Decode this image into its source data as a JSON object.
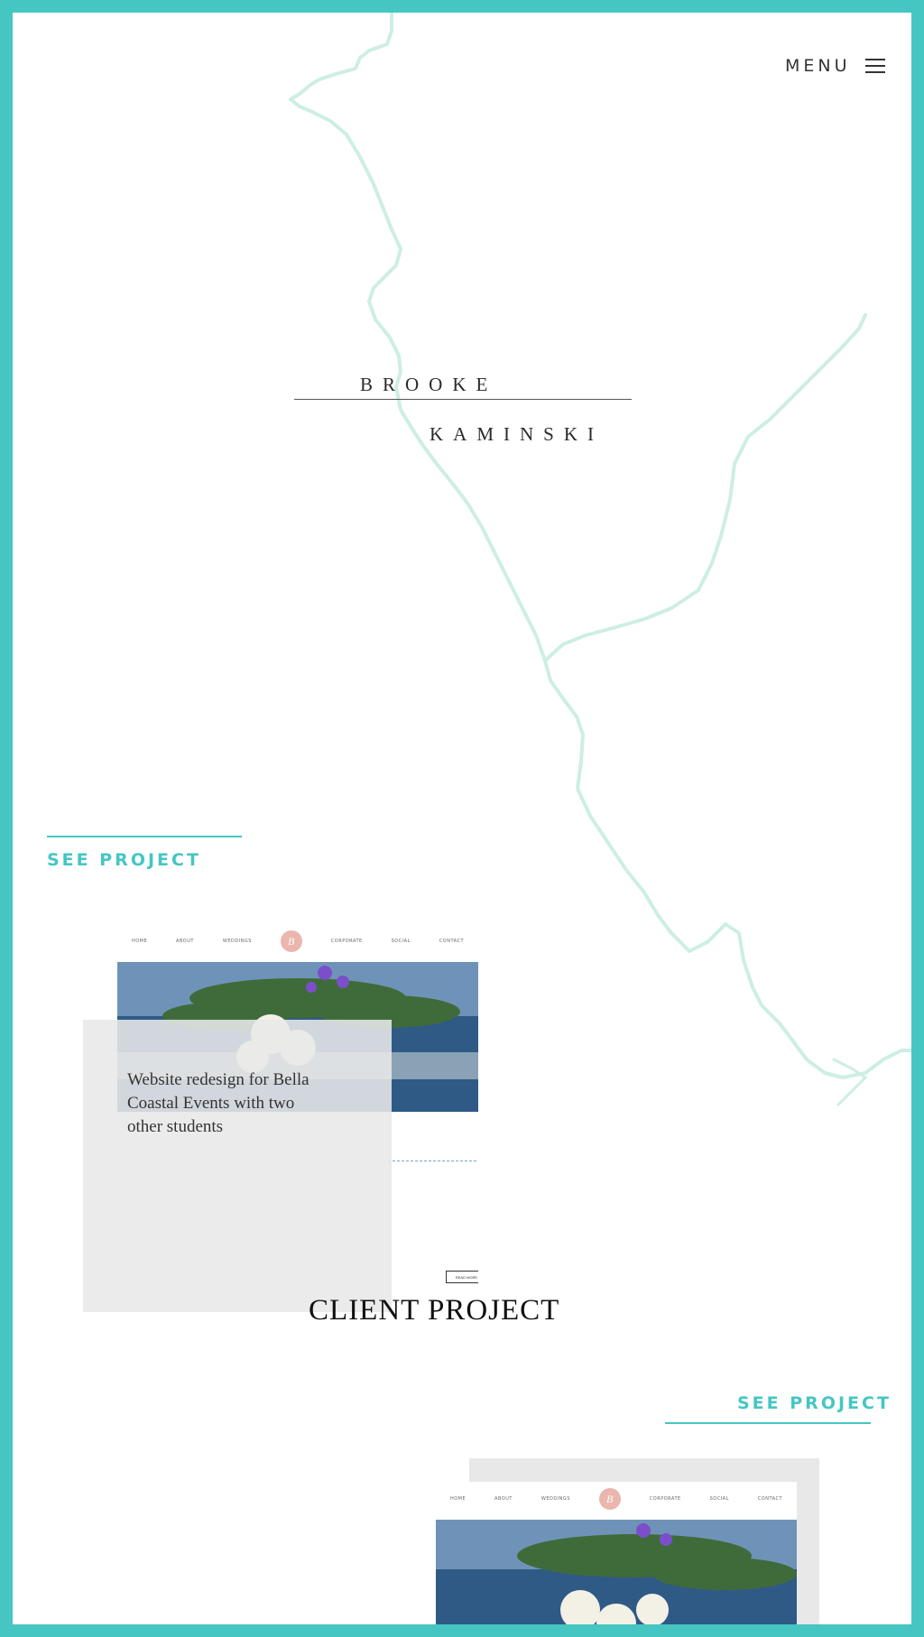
{
  "header": {
    "menu_label": "MENU"
  },
  "hero": {
    "first_name": "BROOKE",
    "last_name": "KAMINSKI"
  },
  "projects": [
    {
      "see_project_label": "SEE PROJECT",
      "description": "Website redesign for Bella Coastal Events with two other students",
      "title": "CLIENT PROJECT",
      "mock": {
        "nav_items": [
          "HOME",
          "ABOUT",
          "WEDDINGS",
          "CORPORATE",
          "SOCIAL",
          "CONTACT"
        ],
        "logo": "B",
        "read_more": "READ MORE"
      }
    },
    {
      "see_project_label": "SEE PROJECT",
      "mock": {
        "nav_items": [
          "HOME",
          "ABOUT",
          "WEDDINGS",
          "CORPORATE",
          "SOCIAL",
          "CONTACT"
        ],
        "logo": "B"
      }
    }
  ],
  "colors": {
    "frame": "#45c6c3",
    "accent": "#45c6c3",
    "river": "#cdeee4",
    "card_overlay": "#e8e8e8"
  }
}
